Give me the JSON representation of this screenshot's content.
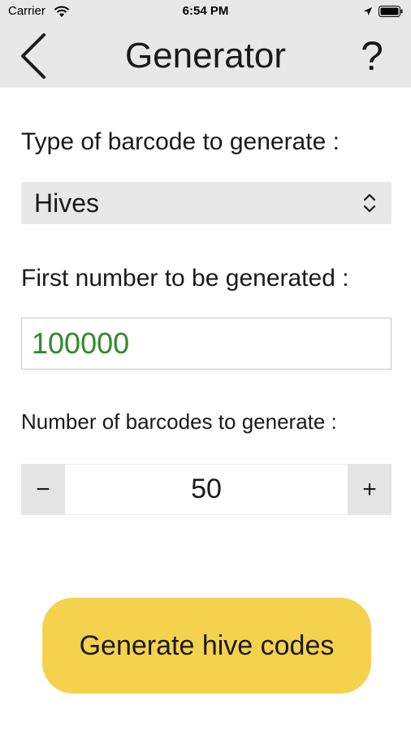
{
  "status_bar": {
    "carrier": "Carrier",
    "time": "6:54 PM",
    "icons": [
      "wifi-icon",
      "location-icon",
      "battery-icon"
    ]
  },
  "nav": {
    "title": "Generator",
    "back_icon": "chevron-left-icon",
    "help_label": "?"
  },
  "form": {
    "type_label": "Type of barcode to generate :",
    "type_selected": "Hives",
    "type_icon": "up-down-chevron-icon",
    "first_number_label": "First number to be generated :",
    "first_number_value": "100000",
    "count_label": "Number of barcodes to generate :",
    "count_minus": "−",
    "count_value": "50",
    "count_plus": "+"
  },
  "actions": {
    "generate_label": "Generate hive codes"
  },
  "colors": {
    "bar_background": "#e8e8e8",
    "input_text": "#2e8b2e",
    "button_background": "#f5d24e"
  }
}
